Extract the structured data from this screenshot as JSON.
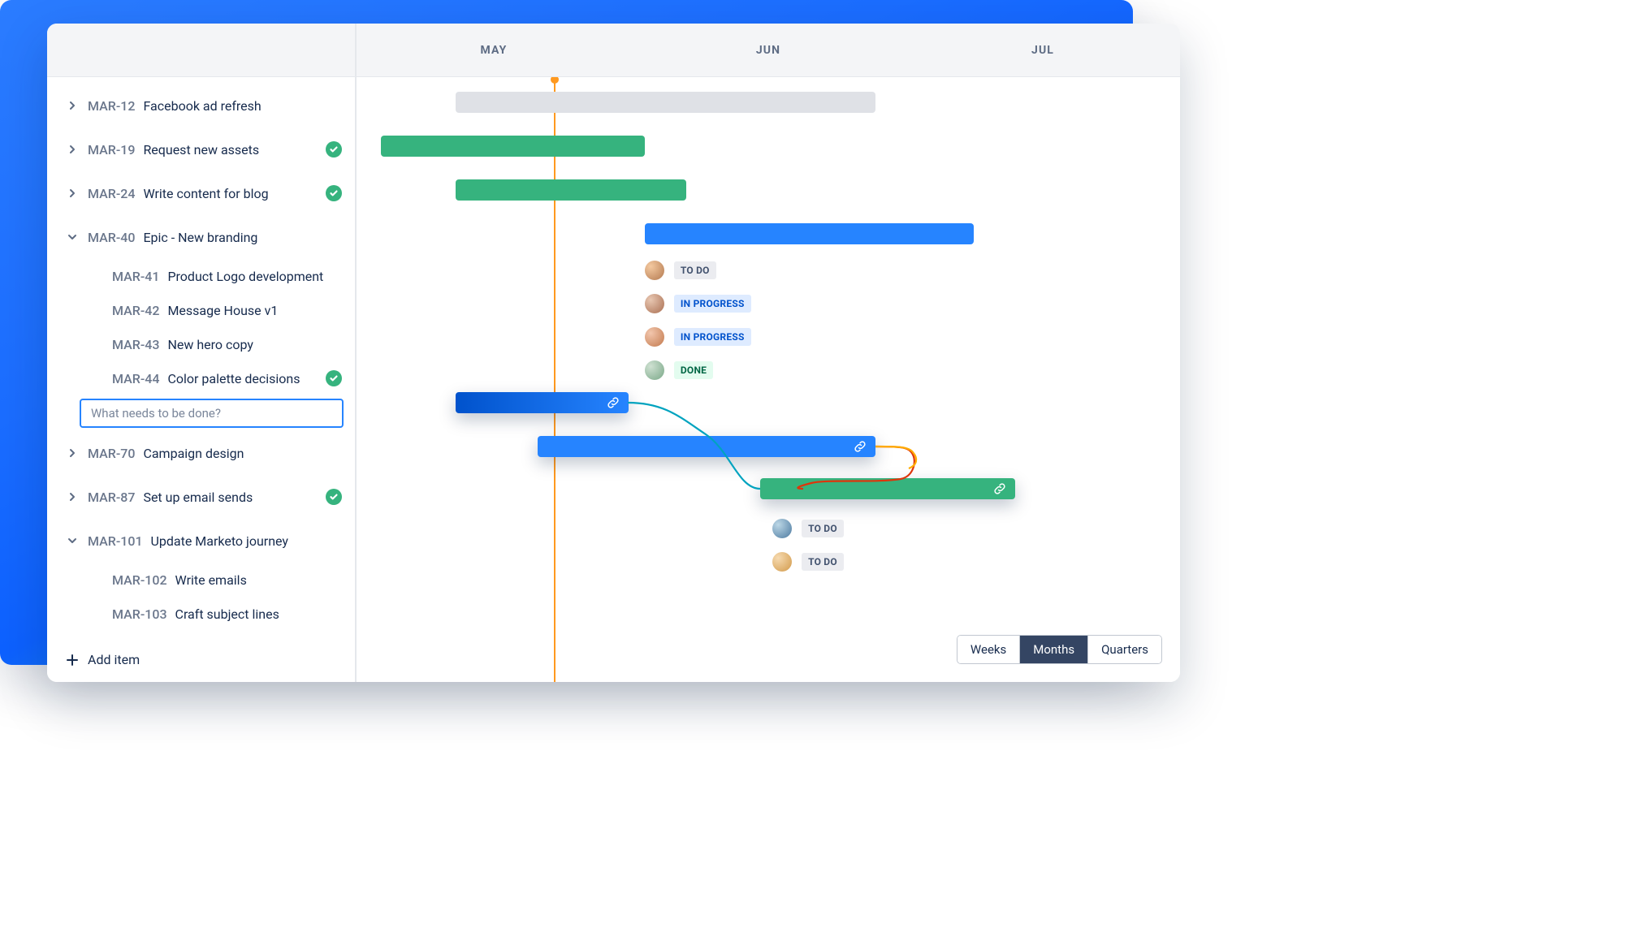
{
  "colors": {
    "blue": "#2684ff",
    "green": "#36b37e",
    "gray": "#dfe1e6",
    "orange": "#ff991f"
  },
  "header": {
    "months": [
      "MAY",
      "JUN",
      "JUL"
    ]
  },
  "today_position_pct": 24,
  "sidebar": {
    "items": [
      {
        "key": "MAR-12",
        "title": "Facebook ad refresh",
        "expandable": true,
        "expanded": false,
        "done": false
      },
      {
        "key": "MAR-19",
        "title": "Request new assets",
        "expandable": true,
        "expanded": false,
        "done": true
      },
      {
        "key": "MAR-24",
        "title": "Write content for blog",
        "expandable": true,
        "expanded": false,
        "done": true
      },
      {
        "key": "MAR-40",
        "title": "Epic - New branding",
        "expandable": true,
        "expanded": true,
        "done": false,
        "children": [
          {
            "key": "MAR-41",
            "title": "Product Logo development",
            "done": false
          },
          {
            "key": "MAR-42",
            "title": "Message House v1",
            "done": false
          },
          {
            "key": "MAR-43",
            "title": "New hero copy",
            "done": false
          },
          {
            "key": "MAR-44",
            "title": "Color palette decisions",
            "done": true
          }
        ]
      },
      {
        "key": "MAR-70",
        "title": "Campaign design",
        "expandable": true,
        "expanded": false,
        "done": false
      },
      {
        "key": "MAR-87",
        "title": "Set up email sends",
        "expandable": true,
        "expanded": false,
        "done": true
      },
      {
        "key": "MAR-101",
        "title": "Update Marketo journey",
        "expandable": true,
        "expanded": true,
        "done": false,
        "children": [
          {
            "key": "MAR-102",
            "title": "Write emails",
            "done": false
          },
          {
            "key": "MAR-103",
            "title": "Craft subject lines",
            "done": false
          }
        ]
      }
    ],
    "new_item_placeholder": "What needs to be done?",
    "add_item_label": "Add item"
  },
  "timeline": {
    "bars": [
      {
        "id": "mar12",
        "row": 0,
        "color": "gray",
        "start_pct": 12,
        "end_pct": 63
      },
      {
        "id": "mar19",
        "row": 1,
        "color": "green",
        "start_pct": 3,
        "end_pct": 35
      },
      {
        "id": "mar24",
        "row": 2,
        "color": "green",
        "start_pct": 12,
        "end_pct": 40
      },
      {
        "id": "mar40",
        "row": 3,
        "color": "blue",
        "start_pct": 35,
        "end_pct": 75
      },
      {
        "id": "input-bar",
        "row": 8,
        "color": "blue-grad",
        "start_pct": 12,
        "end_pct": 33,
        "link": true,
        "shadow": true
      },
      {
        "id": "mar70",
        "row": 9,
        "color": "blue",
        "start_pct": 22,
        "end_pct": 63,
        "link": true,
        "shadow": true
      },
      {
        "id": "mar87",
        "row": 10,
        "color": "green",
        "start_pct": 49,
        "end_pct": 80,
        "link": true,
        "shadow": true
      }
    ],
    "child_rows": [
      {
        "row": 4,
        "assignee": "a",
        "status": "TO DO",
        "status_kind": "todo"
      },
      {
        "row": 5,
        "assignee": "b",
        "status": "IN PROGRESS",
        "status_kind": "inprogress"
      },
      {
        "row": 6,
        "assignee": "c",
        "status": "IN PROGRESS",
        "status_kind": "inprogress"
      },
      {
        "row": 7,
        "assignee": "d",
        "status": "DONE",
        "status_kind": "done"
      },
      {
        "row": 12,
        "assignee": "e",
        "status": "TO DO",
        "status_kind": "todo"
      },
      {
        "row": 13,
        "assignee": "f",
        "status": "TO DO",
        "status_kind": "todo"
      }
    ]
  },
  "zoom": {
    "options": [
      "Weeks",
      "Months",
      "Quarters"
    ],
    "active": "Months"
  }
}
